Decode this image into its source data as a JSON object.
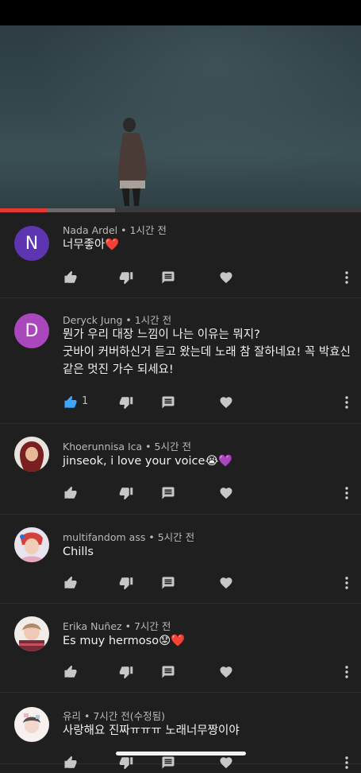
{
  "video": {
    "progress_played": 0.13,
    "progress_buffered": 0.32
  },
  "colors": {
    "accent_red": "#e53935",
    "like_blue": "#3ea6ff"
  },
  "comments": [
    {
      "author": "Nada Ardel",
      "time": "1시간 전",
      "avatar_letter": "N",
      "avatar_color": "#5e35b1",
      "lines": [
        "너무좋아❤️"
      ],
      "likes": "",
      "liked": false
    },
    {
      "author": "Deryck Jung",
      "time": "1시간 전",
      "avatar_letter": "D",
      "avatar_color": "#ab47bc",
      "lines": [
        "뭔가 우리 대장 느낌이 나는 이유는 뭐지?",
        "굿바이 커버하신거 듣고 왔는데 노래 참 잘하네요! 꼭 박효신",
        "같은 멋진 가수 되세요!"
      ],
      "likes": "1",
      "liked": true
    },
    {
      "author": "Khoerunnisa Ica",
      "time": "5시간 전",
      "lines": [
        "jinseok, i love your voice😭💜"
      ],
      "likes": "",
      "liked": false
    },
    {
      "author": "multifandom ass",
      "time": "5시간 전",
      "lines": [
        "Chills"
      ],
      "likes": "",
      "liked": false
    },
    {
      "author": "Erika Nuñez",
      "time": "7시간 전",
      "lines": [
        "Es muy hermoso😟❤️"
      ],
      "likes": "",
      "liked": false
    },
    {
      "author": "유리",
      "time": "7시간 전(수정됨)",
      "lines": [
        "사랑해요 진짜ㅠㅠㅠ 노래너무짱이야"
      ],
      "likes": "",
      "liked": false
    }
  ],
  "meta_separator": " • ",
  "icons": {
    "like": "thumb-up-icon",
    "dislike": "thumb-down-icon",
    "reply": "reply-icon",
    "heart": "heart-icon",
    "more": "more-vertical-icon"
  }
}
